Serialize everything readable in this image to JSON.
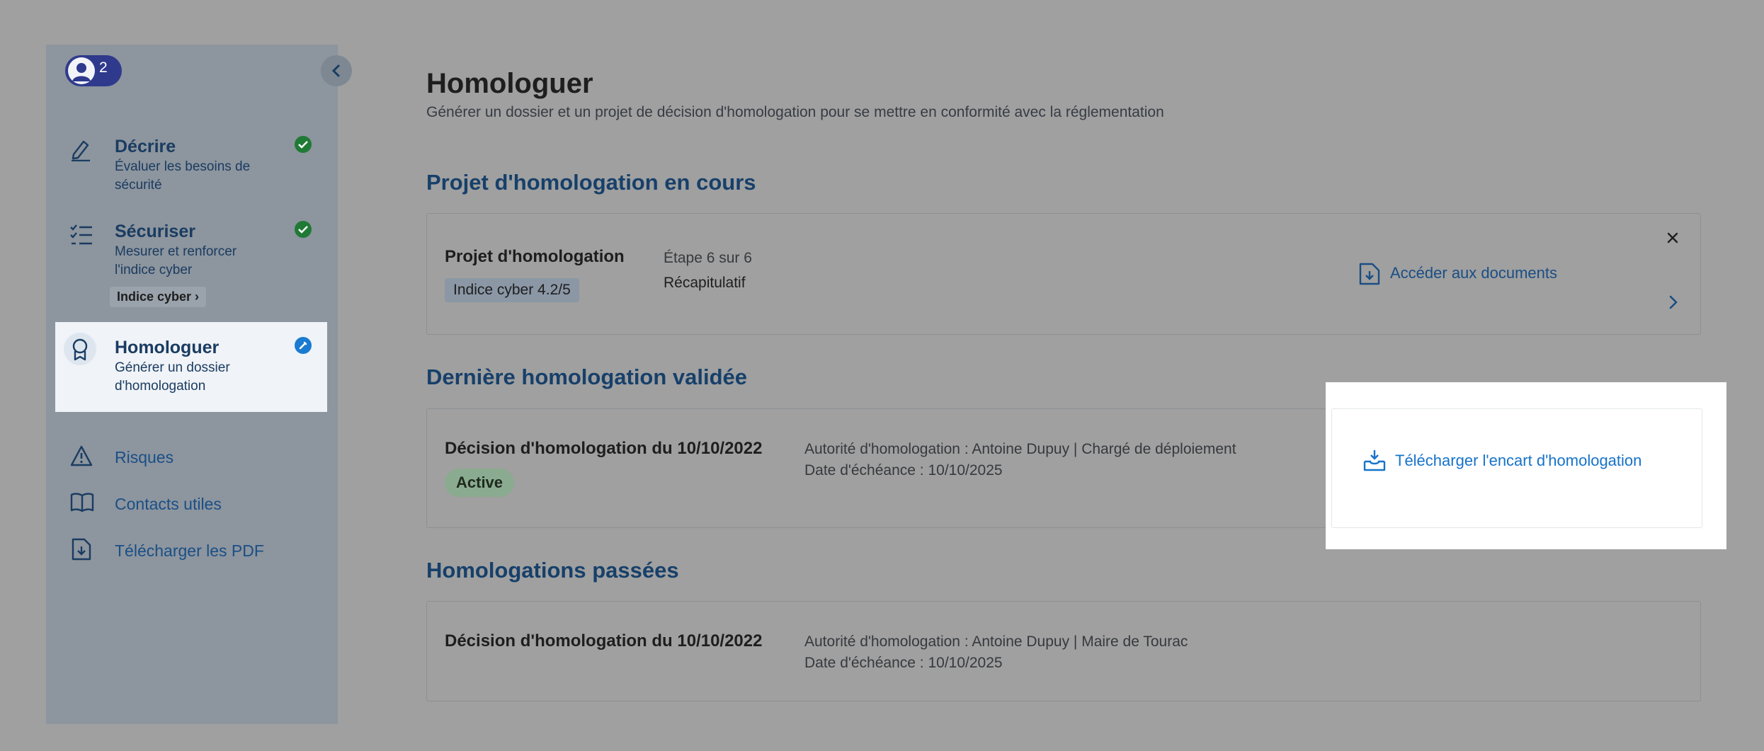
{
  "sidebar": {
    "avatar_count": "2",
    "items": [
      {
        "title": "Décrire",
        "subtitle": "Évaluer les besoins de sécurité",
        "icon": "pencil-icon",
        "status": "check-icon"
      },
      {
        "title": "Sécuriser",
        "subtitle": "Mesurer et renforcer l'indice cyber",
        "icon": "checklist-icon",
        "status": "check-icon",
        "chip": "Indice cyber ›"
      },
      {
        "title": "Homologuer",
        "subtitle": "Générer un dossier d'homologation",
        "icon": "award-icon",
        "status": "edit-icon"
      }
    ],
    "links": [
      {
        "label": "Risques",
        "icon": "warning-icon"
      },
      {
        "label": "Contacts utiles",
        "icon": "book-icon"
      },
      {
        "label": "Télécharger les PDF",
        "icon": "download-file-icon"
      }
    ]
  },
  "main": {
    "title": "Homologuer",
    "subtitle": "Générer un dossier et un projet de décision d'homologation pour se mettre en conformité avec la réglementation",
    "current": {
      "section_title": "Projet d'homologation en cours",
      "card_title": "Projet d'homologation",
      "chip": "Indice cyber 4.2/5",
      "step": "Étape 6 sur 6",
      "step_name": "Récapitulatif",
      "link": "Accéder aux documents"
    },
    "last": {
      "section_title": "Dernière homologation validée",
      "decision": "Décision d'homologation du 10/10/2022",
      "status": "Active",
      "authority": "Autorité d'homologation : Antoine Dupuy | Chargé de déploiement",
      "expiry": "Date d'échéance : 10/10/2025",
      "link": "Télécharger l'encart d'homologation"
    },
    "past": {
      "section_title": "Homologations passées",
      "decision": "Décision d'homologation du 10/10/2022",
      "authority": "Autorité d'homologation : Antoine Dupuy | Maire de Tourac",
      "expiry": "Date d'échéance : 10/10/2025"
    }
  },
  "colors": {
    "overlay": "#a0a0a0",
    "sidebar": "#8d959e",
    "accent_blue": "#1673c9",
    "check_green": "#1f7a35"
  }
}
